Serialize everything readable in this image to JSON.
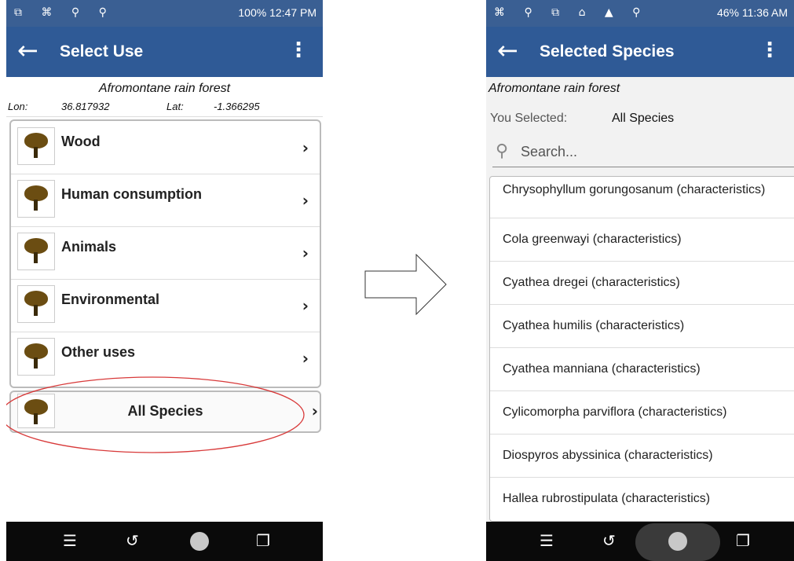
{
  "left_screen": {
    "status": {
      "icons": "⧉ ⌘ ⚲ ⚲",
      "right": "100%  12:47 PM"
    },
    "appbar": {
      "title": "Select Use",
      "back_icon": "arrow-left-icon",
      "menu_icon": "more-vert-icon"
    },
    "location": {
      "forest": "Afromontane rain forest",
      "lon_label": "Lon:",
      "lon_value": "36.817932",
      "lat_label": "Lat:",
      "lat_value": "-1.366295"
    },
    "uses": [
      {
        "label": "Wood"
      },
      {
        "label": "Human consumption"
      },
      {
        "label": "Animals"
      },
      {
        "label": "Environmental"
      },
      {
        "label": "Other uses"
      }
    ],
    "all_species": {
      "label": "All Species"
    },
    "highlight_color": "#d83a3a"
  },
  "right_screen": {
    "status": {
      "icons": "⌘ ⚲ ⧉ ⌂ ▲ ⚲",
      "right": "46%  11:36 AM"
    },
    "appbar": {
      "title": "Selected Species",
      "back_icon": "arrow-left-icon",
      "menu_icon": "more-vert-icon"
    },
    "forest": "Afromontane rain forest",
    "selected_label": "You Selected:",
    "selected_value": "All Species",
    "search_placeholder": "Search...",
    "species": [
      "Chrysophyllum gorungosanum (characteristics)",
      "Cola greenwayi (characteristics)",
      "Cyathea dregei (characteristics)",
      "Cyathea humilis (characteristics)",
      "Cyathea manniana (characteristics)",
      "Cylicomorpha parviflora (characteristics)",
      "Diospyros abyssinica (characteristics)",
      "Hallea rubrostipulata (characteristics)"
    ]
  },
  "colors": {
    "appbar": "#2f5a96",
    "statusbar": "#3a5f93",
    "navbar": "#0a0a0a"
  }
}
